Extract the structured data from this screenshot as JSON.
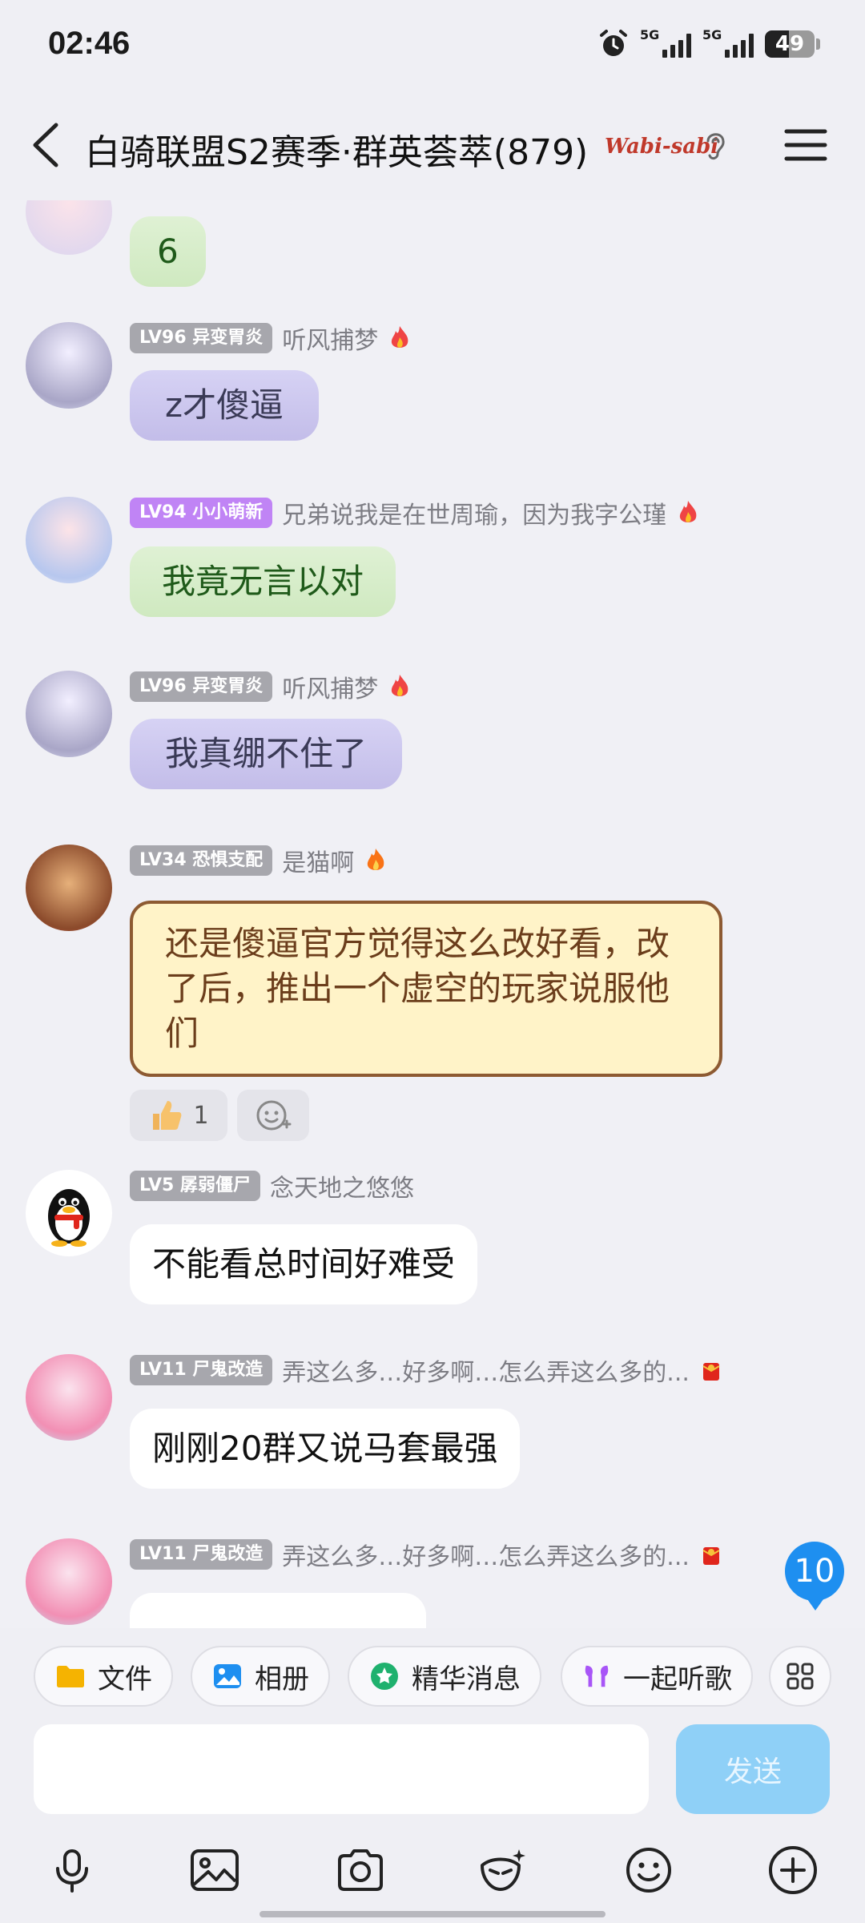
{
  "status_bar": {
    "time": "02:46",
    "network_1": "5G",
    "network_2": "5G",
    "battery": "49",
    "battery_level": 0.49
  },
  "header": {
    "title": "白骑联盟S2赛季·群英荟萃(879)",
    "badge": "Wabi-sabi"
  },
  "messages": [
    {
      "text": "6"
    },
    {
      "level": "LV96 异变胃炎",
      "nick": "听风捕梦",
      "text": "z才傻逼"
    },
    {
      "level": "LV94 小小萌新",
      "nick": "兄弟说我是在世周瑜，因为我字公瑾",
      "text": "我竟无言以对"
    },
    {
      "level": "LV96 异变胃炎",
      "nick": "听风捕梦",
      "text": "我真绷不住了"
    },
    {
      "level": "LV34 恐惧支配",
      "nick": "是猫啊",
      "text": "还是傻逼官方觉得这么改好看，改了后，推出一个虚空的玩家说服他们",
      "reaction_count": "1"
    },
    {
      "level": "LV5 孱弱僵尸",
      "nick": "念天地之悠悠",
      "text": "不能看总时间好难受"
    },
    {
      "level": "LV11 尸鬼改造",
      "nick": "弄这么多…好多啊…怎么弄这么多的...",
      "text": "刚刚20群又说马套最强"
    },
    {
      "level": "LV11 尸鬼改造",
      "nick": "弄这么多…好多啊…怎么弄这么多的...",
      "text": ""
    }
  ],
  "unread_count": "10",
  "shortcuts": {
    "file": "文件",
    "album": "相册",
    "essence": "精华消息",
    "listen": "一起听歌"
  },
  "composer": {
    "send": "发送",
    "input_value": ""
  },
  "colors": {
    "accent": "#1e8ff0",
    "send_disabled": "#8fd0f7",
    "level_gray": "#a7a7ad",
    "level_purple": "#c084f5"
  }
}
